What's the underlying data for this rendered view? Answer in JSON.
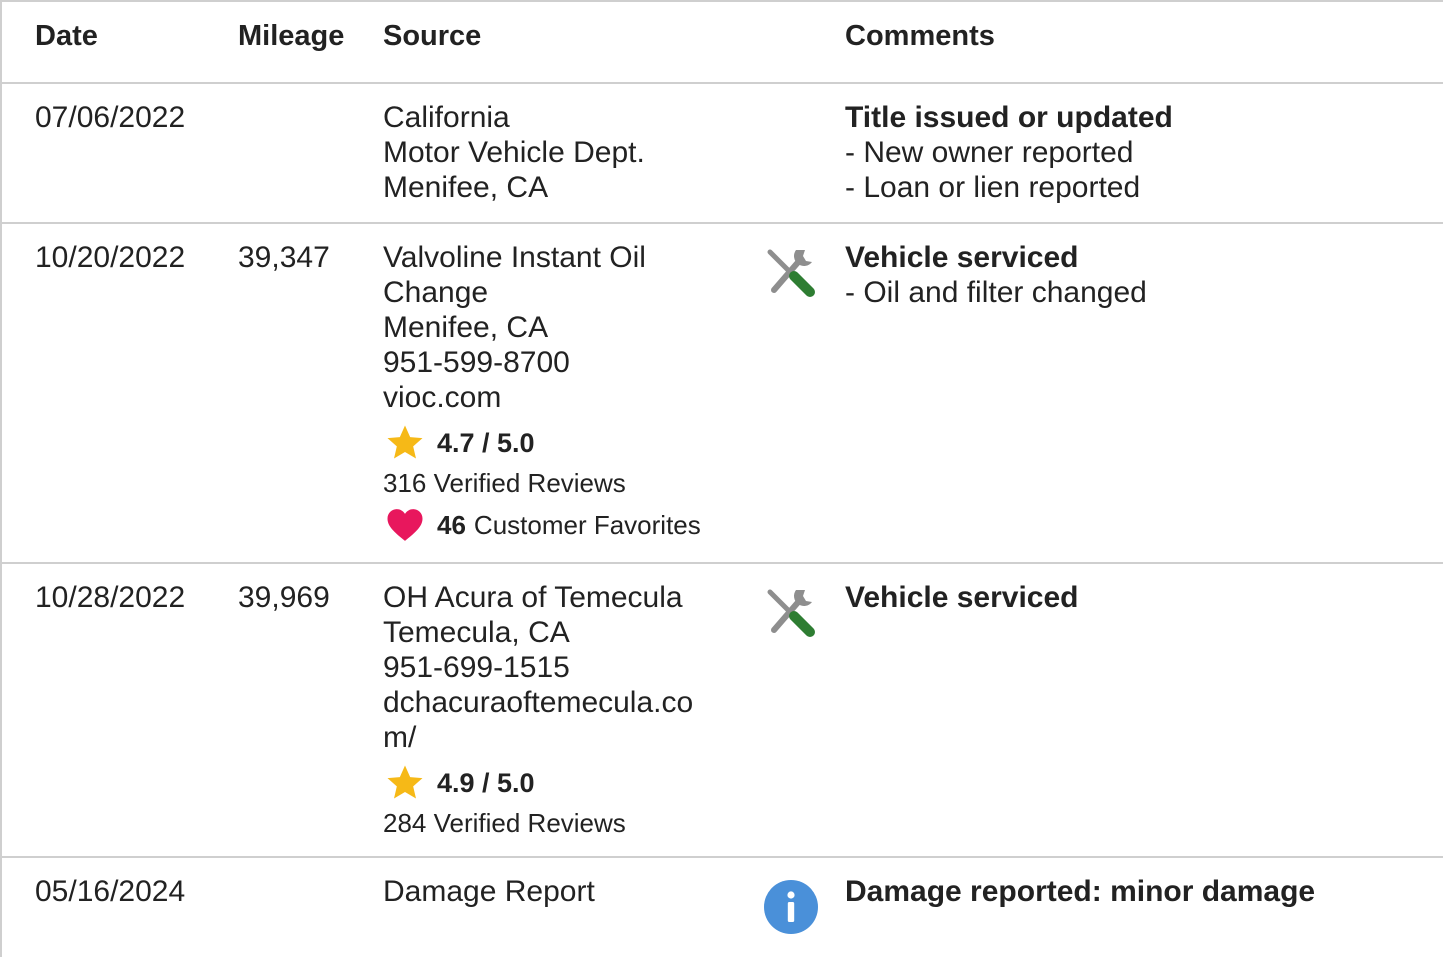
{
  "headers": {
    "date": "Date",
    "mileage": "Mileage",
    "source": "Source",
    "comments": "Comments"
  },
  "rows": [
    {
      "date": "07/06/2022",
      "mileage": "",
      "source_lines": [
        "California",
        "Motor Vehicle Dept.",
        "Menifee, CA"
      ],
      "icon": "none",
      "comment_title": "Title issued or updated",
      "comment_items": [
        "- New owner reported",
        "- Loan or lien reported"
      ]
    },
    {
      "date": "10/20/2022",
      "mileage": "39,347",
      "source_lines": [
        "Valvoline Instant Oil",
        "Change",
        "Menifee, CA",
        "951-599-8700",
        "vioc.com"
      ],
      "rating": "4.7 / 5.0",
      "reviews": "316 Verified Reviews",
      "favorites_count": "46",
      "favorites_label": "Customer Favorites",
      "icon": "tools-icon",
      "comment_title": "Vehicle serviced",
      "comment_items": [
        "- Oil and filter changed"
      ]
    },
    {
      "date": "10/28/2022",
      "mileage": "39,969",
      "source_lines": [
        "OH Acura of Temecula",
        "Temecula, CA",
        "951-699-1515"
      ],
      "source_url": "dchacuraoftemecula.com/",
      "rating": "4.9 / 5.0",
      "reviews": "284 Verified Reviews",
      "icon": "tools-icon",
      "comment_title": "Vehicle serviced",
      "comment_items": []
    },
    {
      "date": "05/16/2024",
      "mileage": "",
      "source_lines": [
        "Damage Report"
      ],
      "icon": "info-icon",
      "comment_title": "Damage reported: minor damage",
      "comment_items": []
    }
  ],
  "colors": {
    "star": "#F6B917",
    "heart": "#E8175D",
    "info": "#4A90D9",
    "tool_handle": "#2E7D32",
    "tool_metal": "#8E8E8E",
    "divider": "#CFCFCF"
  }
}
